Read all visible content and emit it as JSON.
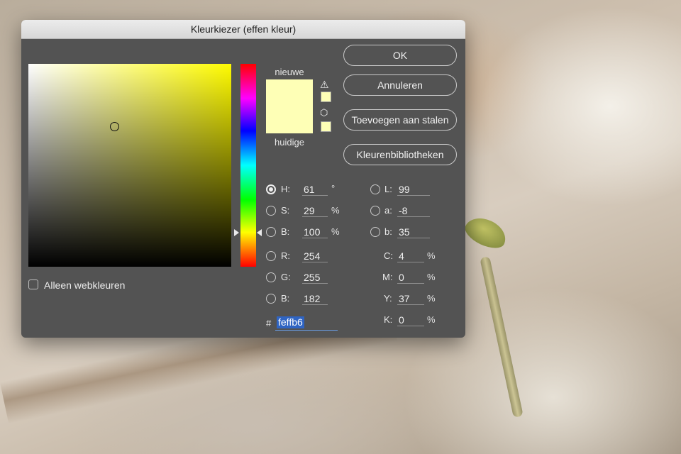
{
  "dialog": {
    "title": "Kleurkiezer (effen kleur)"
  },
  "preview": {
    "new_label": "nieuwe",
    "current_label": "huidige",
    "new_color": "#feffb6",
    "current_color": "#feffb6",
    "warning_icon": "warning-triangle-icon",
    "web_safe_icon": "cube-icon"
  },
  "buttons": {
    "ok": "OK",
    "cancel": "Annuleren",
    "add_swatches": "Toevoegen aan stalen",
    "color_libraries": "Kleurenbibliotheken"
  },
  "hsb": {
    "h_label": "H:",
    "h_value": "61",
    "h_unit": "°",
    "s_label": "S:",
    "s_value": "29",
    "s_unit": "%",
    "b_label": "B:",
    "b_value": "100",
    "b_unit": "%",
    "selected": "H"
  },
  "lab": {
    "l_label": "L:",
    "l_value": "99",
    "a_label": "a:",
    "a_value": "-8",
    "b_label": "b:",
    "b_value": "35"
  },
  "rgb": {
    "r_label": "R:",
    "r_value": "254",
    "g_label": "G:",
    "g_value": "255",
    "b_label": "B:",
    "b_value": "182"
  },
  "cmyk": {
    "c_label": "C:",
    "c_value": "4",
    "c_unit": "%",
    "m_label": "M:",
    "m_value": "0",
    "m_unit": "%",
    "y_label": "Y:",
    "y_value": "37",
    "y_unit": "%",
    "k_label": "K:",
    "k_value": "0",
    "k_unit": "%"
  },
  "hex": {
    "prefix": "#",
    "value": "feffb6"
  },
  "web_only": {
    "label": "Alleen webkleuren",
    "checked": false
  },
  "hue_field": {
    "hue_color": "#fffb00"
  }
}
